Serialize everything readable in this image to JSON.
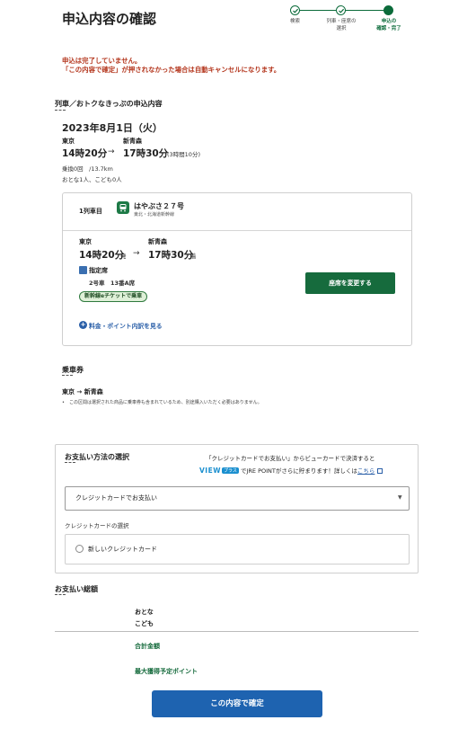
{
  "page": {
    "title": "申込内容の確認"
  },
  "steps": [
    {
      "label_line1": "検索",
      "label_line2": "",
      "state": "done"
    },
    {
      "label_line1": "列車・座席の",
      "label_line2": "選択",
      "state": "done"
    },
    {
      "label_line1": "申込の",
      "label_line2": "確認・完了",
      "state": "current"
    }
  ],
  "warning": {
    "line1": "申込は完了していません。",
    "line2": "「この内容で確定」が押されなかった場合は自動キャンセルになります。"
  },
  "application": {
    "heading": "列車／おトクなきっぷの申込内容",
    "date": "2023年8月1日（火）",
    "from_station": "東京",
    "to_station": "新青森",
    "depart_time": "14時20分",
    "arrive_time": "17時30分",
    "duration": "(3時間10分)",
    "arrow": "→",
    "transfer_info": "乗換0回　/13.7km",
    "passengers": "おとな1人、こども0人",
    "leg": {
      "label": "1列車目",
      "train_name": "はやぶさ２７号",
      "line_name": "東北・北海道新幹線",
      "from_station": "東京",
      "to_station": "新青森",
      "depart_time": "14時20分",
      "depart_suffix": "発",
      "arrive_time": "17時30分",
      "arrive_suffix": "着",
      "seat_type": "指定席",
      "seat_detail": "2号車　13番A席",
      "eticket_badge": "新幹線eチケットで乗車",
      "change_seat_button": "座席を変更する",
      "fare_link": "料金・ポイント内訳を見る"
    }
  },
  "ticket": {
    "heading": "乗車券",
    "route": "東京 → 新青森",
    "note": "この区間は選択された商品に乗車券も含まれているため、別途購入いただく必要はありません。"
  },
  "payment": {
    "heading": "お支払い方法の選択",
    "promo_line1": "「クレジットカードでお支払い」からビューカードで決済すると",
    "promo_view": "VIEW",
    "promo_plus": "プラス",
    "promo_line2": "でJRE POINTがさらに貯まります！詳しくは",
    "promo_link": "こちら",
    "selected_method": "クレジットカードでお支払い",
    "card_select_label": "クレジットカードの選択",
    "new_card_option": "新しいクレジットカード"
  },
  "totals": {
    "heading": "お支払い総額",
    "adult_label": "おとな",
    "child_label": "こども",
    "total_label": "合計金額",
    "points_label": "最大獲得予定ポイント"
  },
  "confirm_button": "この内容で確定",
  "colors": {
    "brand_green": "#166b3d",
    "warning_red": "#b4361d",
    "confirm_blue": "#1e63b0",
    "link_blue": "#2a5fa8"
  }
}
